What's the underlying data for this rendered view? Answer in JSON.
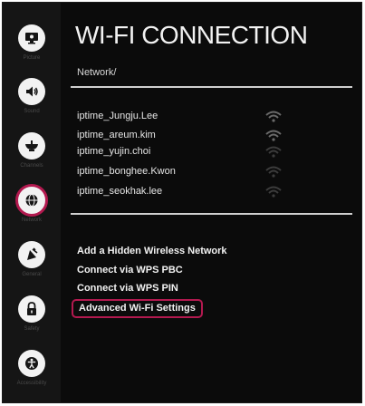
{
  "header": {
    "title": "WI-FI CONNECTION",
    "breadcrumb": "Network/"
  },
  "sidebar": {
    "items": [
      {
        "label": "Picture",
        "icon": "picture-icon",
        "selected": false
      },
      {
        "label": "Sound",
        "icon": "sound-icon",
        "selected": false
      },
      {
        "label": "Channels",
        "icon": "channels-icon",
        "selected": false
      },
      {
        "label": "Network",
        "icon": "network-icon",
        "selected": true
      },
      {
        "label": "General",
        "icon": "general-icon",
        "selected": false
      },
      {
        "label": "Safety",
        "icon": "lock-icon",
        "selected": false
      },
      {
        "label": "Accessibility",
        "icon": "accessibility-icon",
        "selected": false
      }
    ]
  },
  "networks": [
    {
      "name": "iptime_Jungju.Lee",
      "icon": "wifi-signal-icon"
    },
    {
      "name": "iptime_areum.kim",
      "icon": "wifi-signal-icon"
    },
    {
      "name": "iptime_yujin.choi",
      "icon": "wifi-signal-icon"
    },
    {
      "name": "iptime_bonghee.Kwon",
      "icon": "wifi-signal-icon"
    },
    {
      "name": "iptime_seokhak.lee",
      "icon": "wifi-signal-icon"
    }
  ],
  "actions": {
    "add_hidden": "Add a Hidden Wireless Network",
    "wps_pbc": "Connect via WPS PBC",
    "wps_pin": "Connect via WPS PIN",
    "advanced": "Advanced Wi-Fi Settings"
  },
  "colors": {
    "background": "#0b0b0b",
    "sidebar": "#151515",
    "accent": "#b3194f",
    "text": "#f2f2f2"
  }
}
